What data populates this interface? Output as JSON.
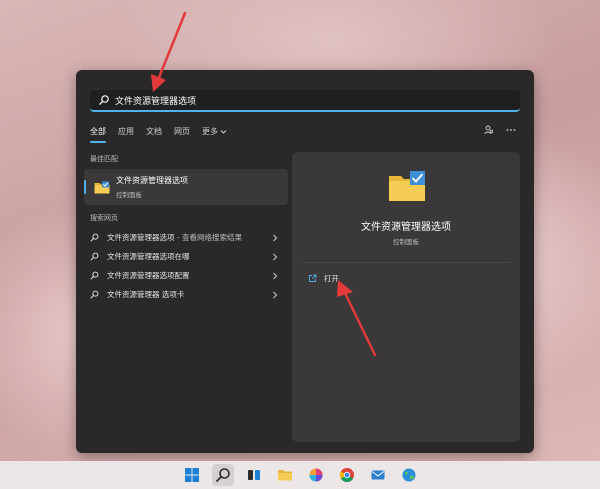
{
  "search": {
    "value": "文件资源管理器选项"
  },
  "tabs": [
    {
      "label": "全部"
    },
    {
      "label": "应用"
    },
    {
      "label": "文档"
    },
    {
      "label": "网页"
    },
    {
      "label": "更多"
    }
  ],
  "best_match": {
    "section_label": "最佳匹配",
    "title": "文件资源管理器选项",
    "subtitle": "控制面板"
  },
  "web_search": {
    "section_label": "搜索网页",
    "items": [
      {
        "bold": "文件资源管理器选项",
        "rest": " - 查看网络搜索结果"
      },
      {
        "bold": "文件资源管理器选项在哪",
        "rest": ""
      },
      {
        "bold": "文件资源管理器选项配置",
        "rest": ""
      },
      {
        "bold": "文件资源管理器 选项卡",
        "rest": ""
      }
    ]
  },
  "detail": {
    "title": "文件资源管理器选项",
    "subtitle": "控制面板",
    "open_label": "打开"
  },
  "colors": {
    "panel": "#2a2828",
    "accent": "#4fb3e8",
    "annotation_arrow": "#e23a3a"
  },
  "taskbar": {
    "icons": [
      "windows-start-icon",
      "search-icon",
      "task-view-icon",
      "file-explorer-icon",
      "photos-icon",
      "chrome-icon",
      "mail-icon",
      "globe-icon"
    ]
  }
}
